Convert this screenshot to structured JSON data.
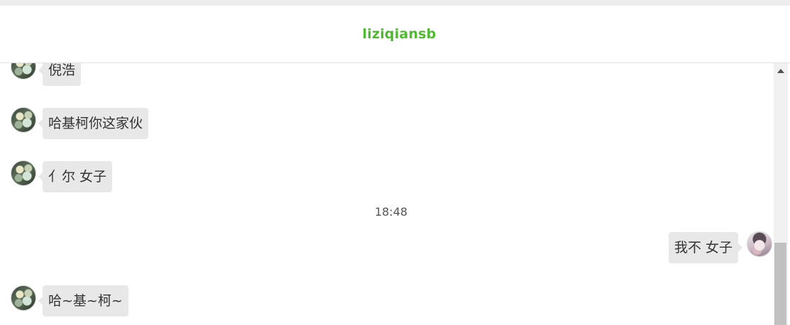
{
  "header": {
    "title": "liziqiansb",
    "title_color": "#4fba2f"
  },
  "messages": [
    {
      "side": "left",
      "text": "倪浩"
    },
    {
      "side": "left",
      "text": "哈基柯你这家伙"
    },
    {
      "side": "left",
      "text": "亻尔 女子"
    },
    {
      "side": "right",
      "text": "我不 女子"
    },
    {
      "side": "left",
      "text": "哈~基~柯~"
    }
  ],
  "timestamp": "18:48",
  "colors": {
    "bubble_bg": "#e8e8e8",
    "scrollbar_thumb": "#c1c1c1"
  }
}
